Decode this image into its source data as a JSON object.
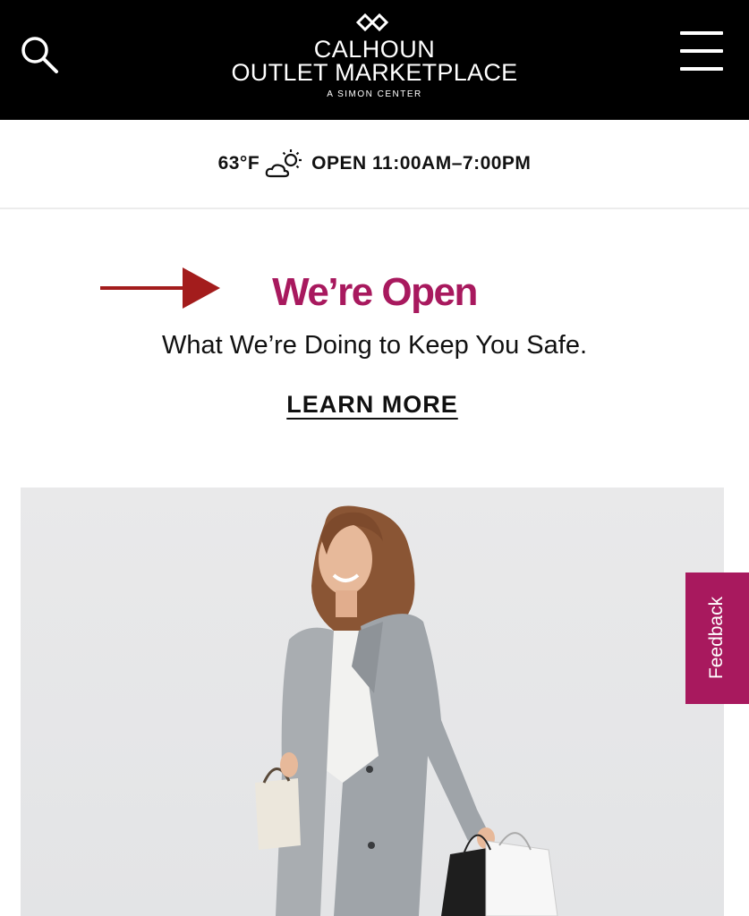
{
  "header": {
    "logo_line1": "CALHOUN",
    "logo_line2": "OUTLET MARKETPLACE",
    "logo_sub": "A SIMON CENTER",
    "search_icon": "search-icon",
    "menu_icon": "hamburger-menu-icon"
  },
  "infobar": {
    "temperature": "63°F",
    "weather_icon": "partly-sunny-icon",
    "hours": "OPEN 11:00AM–7:00PM"
  },
  "banner": {
    "headline": "We’re Open",
    "subhead": "What We’re Doing to Keep You Safe.",
    "cta": "LEARN MORE",
    "arrow_color": "#a31c1c",
    "headline_color": "#a8195e"
  },
  "hero": {
    "image": "woman-in-grey-trench-coat-with-shopping-bags"
  },
  "feedback": {
    "label": "Feedback",
    "color": "#a8195e"
  }
}
